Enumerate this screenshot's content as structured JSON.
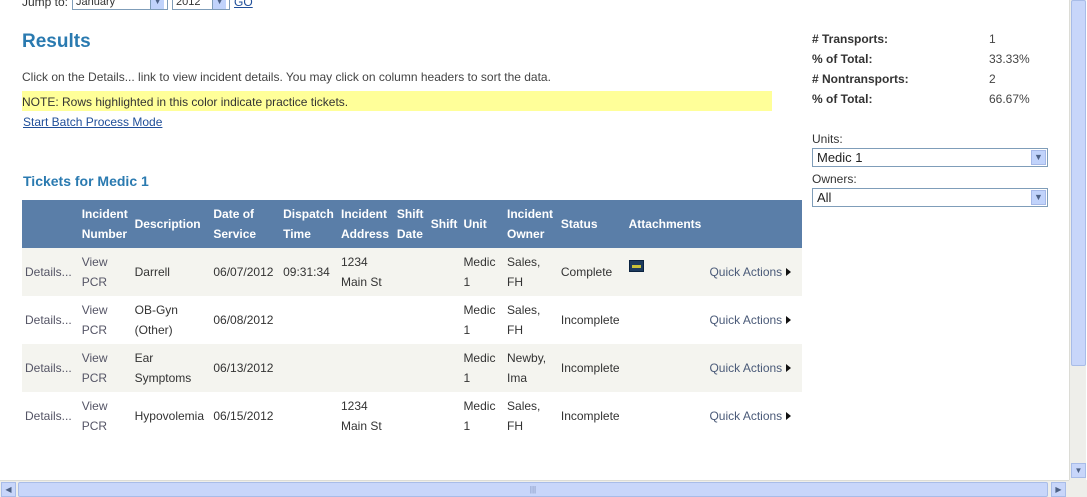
{
  "jump": {
    "label": "Jump to:",
    "month": "January",
    "year": "2012",
    "go": "GO"
  },
  "results": {
    "title": "Results",
    "hint": "Click on the Details... link to view incident details. You may click on column headers to sort the data.",
    "note": "NOTE: Rows highlighted in this color indicate practice tickets.",
    "batch_link": "Start Batch Process Mode",
    "tickets_title": "Tickets for Medic 1"
  },
  "table": {
    "headers": {
      "incident_number": "Incident Number",
      "description": "Description",
      "date_of_service": "Date of Service",
      "dispatch_time": "Dispatch Time",
      "incident_address": "Incident Address",
      "shift_date": "Shift Date",
      "shift": "Shift",
      "unit": "Unit",
      "incident_owner": "Incident Owner",
      "status": "Status",
      "attachments": "Attachments"
    },
    "rows": [
      {
        "details": "Details...",
        "view": "View PCR",
        "description": "Darrell",
        "date": "06/07/2012",
        "dispatch": "09:31:34",
        "address": "1234 Main St",
        "shift_date": "",
        "shift": "",
        "unit": "Medic 1",
        "owner": "Sales, FH",
        "status": "Complete",
        "quick": "Quick Actions"
      },
      {
        "details": "Details...",
        "view": "View PCR",
        "description": "OB-Gyn (Other)",
        "date": "06/08/2012",
        "dispatch": "",
        "address": "",
        "shift_date": "",
        "shift": "",
        "unit": "Medic 1",
        "owner": "Sales, FH",
        "status": "Incomplete",
        "quick": "Quick Actions"
      },
      {
        "details": "Details...",
        "view": "View PCR",
        "description": "Ear Symptoms",
        "date": "06/13/2012",
        "dispatch": "",
        "address": "",
        "shift_date": "",
        "shift": "",
        "unit": "Medic 1",
        "owner": "Newby, Ima",
        "status": "Incomplete",
        "quick": "Quick Actions"
      },
      {
        "details": "Details...",
        "view": "View PCR",
        "description": "Hypovolemia",
        "date": "06/15/2012",
        "dispatch": "",
        "address": "1234 Main St",
        "shift_date": "",
        "shift": "",
        "unit": "Medic 1",
        "owner": "Sales, FH",
        "status": "Incomplete",
        "quick": "Quick Actions"
      }
    ]
  },
  "sidebar": {
    "stats": [
      {
        "label": "# Transports:",
        "value": "1"
      },
      {
        "label": "% of Total:",
        "value": "33.33%"
      },
      {
        "label": "# Nontransports:",
        "value": "2"
      },
      {
        "label": "% of Total:",
        "value": "66.67%"
      }
    ],
    "units_label": "Units:",
    "units_value": "Medic 1",
    "owners_label": "Owners:",
    "owners_value": "All"
  },
  "colors": {
    "accent": "#2a7ab0",
    "header_bg": "#5a7ea8",
    "note_bg": "#ffff99",
    "alt_row": "#f4f4ef"
  }
}
